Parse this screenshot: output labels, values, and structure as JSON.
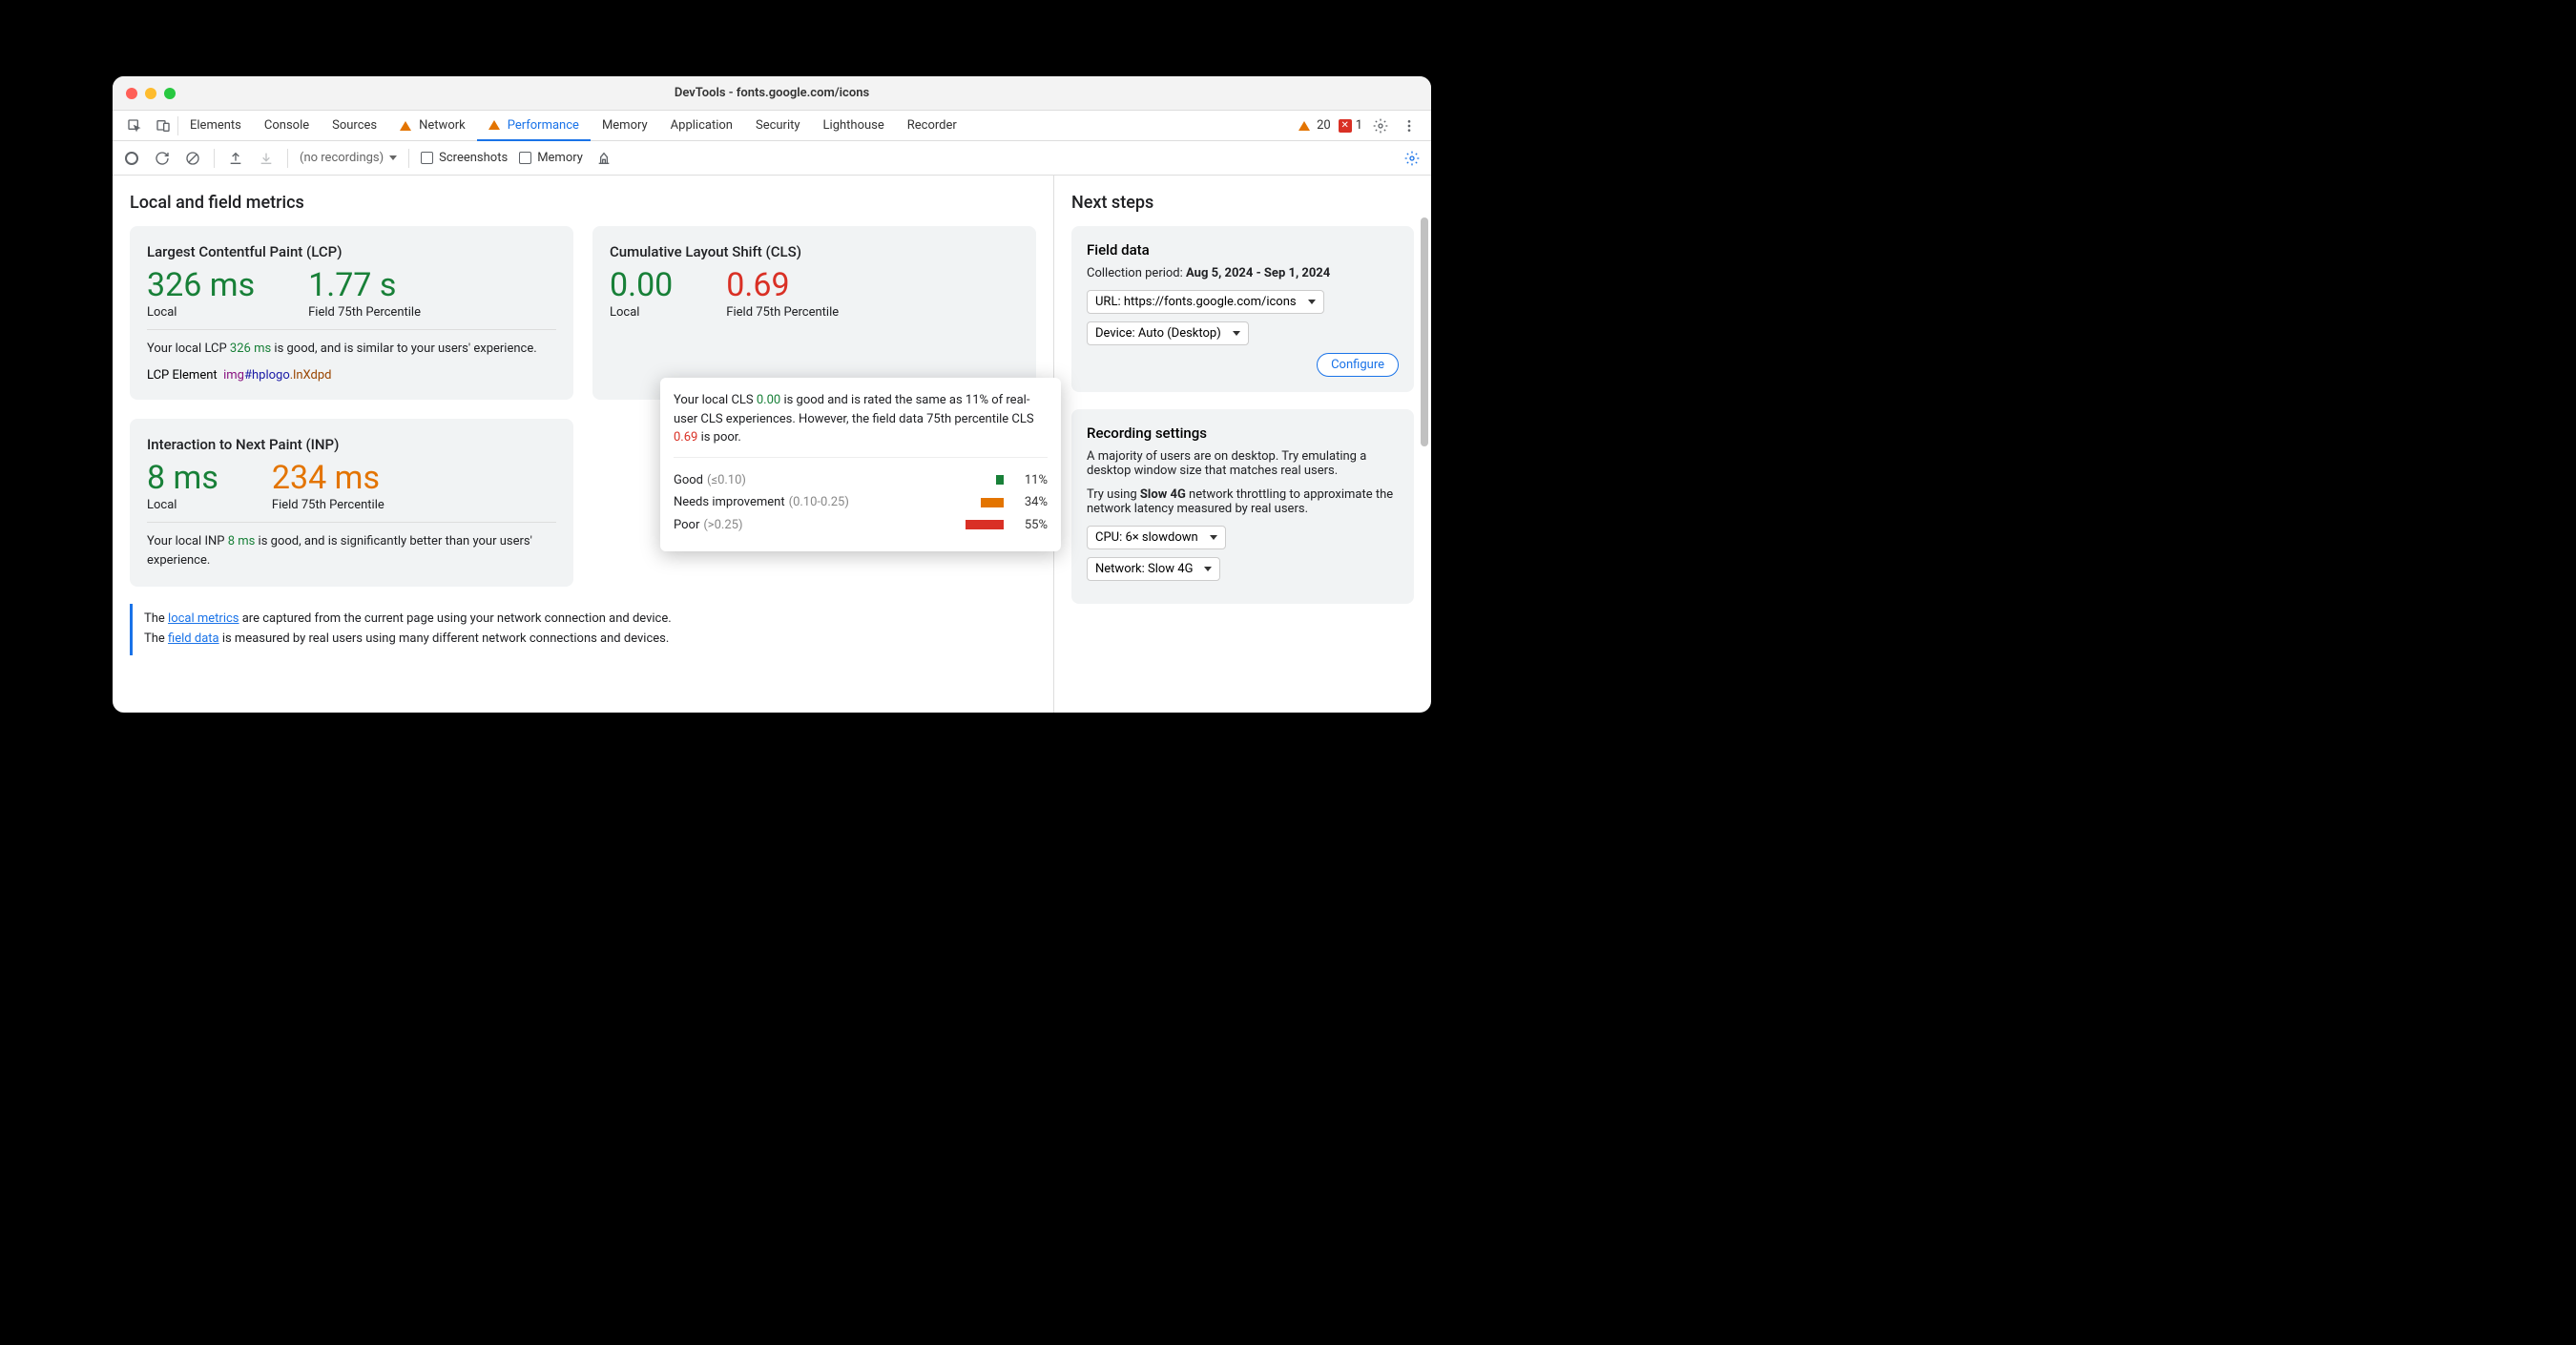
{
  "window": {
    "title": "DevTools - fonts.google.com/icons"
  },
  "tabs": {
    "items": [
      "Elements",
      "Console",
      "Sources",
      "Network",
      "Performance",
      "Memory",
      "Application",
      "Security",
      "Lighthouse",
      "Recorder"
    ],
    "active": "Performance",
    "warn_tabs": [
      "Network",
      "Performance"
    ],
    "warnings": "20",
    "errors": "1"
  },
  "toolbar": {
    "recordings": "(no recordings)",
    "screenshots": "Screenshots",
    "memory": "Memory"
  },
  "main": {
    "heading": "Local and field metrics",
    "lcp": {
      "title": "Largest Contentful Paint (LCP)",
      "local_val": "326 ms",
      "local_lbl": "Local",
      "field_val": "1.77 s",
      "field_lbl": "Field 75th Percentile",
      "desc_pre": "Your local LCP ",
      "desc_val": "326 ms",
      "desc_post": " is good, and is similar to your users' experience.",
      "el_label": "LCP Element",
      "el_tag": "img",
      "el_id": "#hplogo",
      "el_cls": ".lnXdpd"
    },
    "cls": {
      "title": "Cumulative Layout Shift (CLS)",
      "local_val": "0.00",
      "local_lbl": "Local",
      "field_val": "0.69",
      "field_lbl": "Field 75th Percentile",
      "tip_pre": "Your local CLS ",
      "tip_v1": "0.00",
      "tip_mid": " is good and is rated the same as 11% of real-user CLS experiences. However, the field data 75th percentile CLS ",
      "tip_v2": "0.69",
      "tip_post": " is poor.",
      "dist": {
        "good_l": "Good",
        "good_r": "(≤0.10)",
        "good_p": "11%",
        "good_w": 8,
        "good_c": "#188038",
        "ni_l": "Needs improvement",
        "ni_r": "(0.10-0.25)",
        "ni_p": "34%",
        "ni_w": 24,
        "ni_c": "#e37400",
        "poor_l": "Poor",
        "poor_r": "(>0.25)",
        "poor_p": "55%",
        "poor_w": 40,
        "poor_c": "#d93025"
      }
    },
    "inp": {
      "title": "Interaction to Next Paint (INP)",
      "local_val": "8 ms",
      "local_lbl": "Local",
      "field_val": "234 ms",
      "field_lbl": "Field 75th Percentile",
      "desc_pre": "Your local INP ",
      "desc_val": "8 ms",
      "desc_post": " is good, and is significantly better than your users' experience."
    },
    "footer": {
      "l1a": "The ",
      "l1link": "local metrics",
      "l1b": " are captured from the current page using your network connection and device.",
      "l2a": "The ",
      "l2link": "field data",
      "l2b": " is measured by real users using many different network connections and devices."
    }
  },
  "side": {
    "heading": "Next steps",
    "field": {
      "title": "Field data",
      "period_l": "Collection period: ",
      "period_v": "Aug 5, 2024 - Sep 1, 2024",
      "url": "URL: https://fonts.google.com/icons",
      "device": "Device: Auto (Desktop)",
      "configure": "Configure"
    },
    "rec": {
      "title": "Recording settings",
      "p1": "A majority of users are on desktop. Try emulating a desktop window size that matches real users.",
      "p2a": "Try using ",
      "p2b": "Slow 4G",
      "p2c": " network throttling to approximate the network latency measured by real users.",
      "cpu": "CPU: 6× slowdown",
      "net": "Network: Slow 4G"
    }
  }
}
